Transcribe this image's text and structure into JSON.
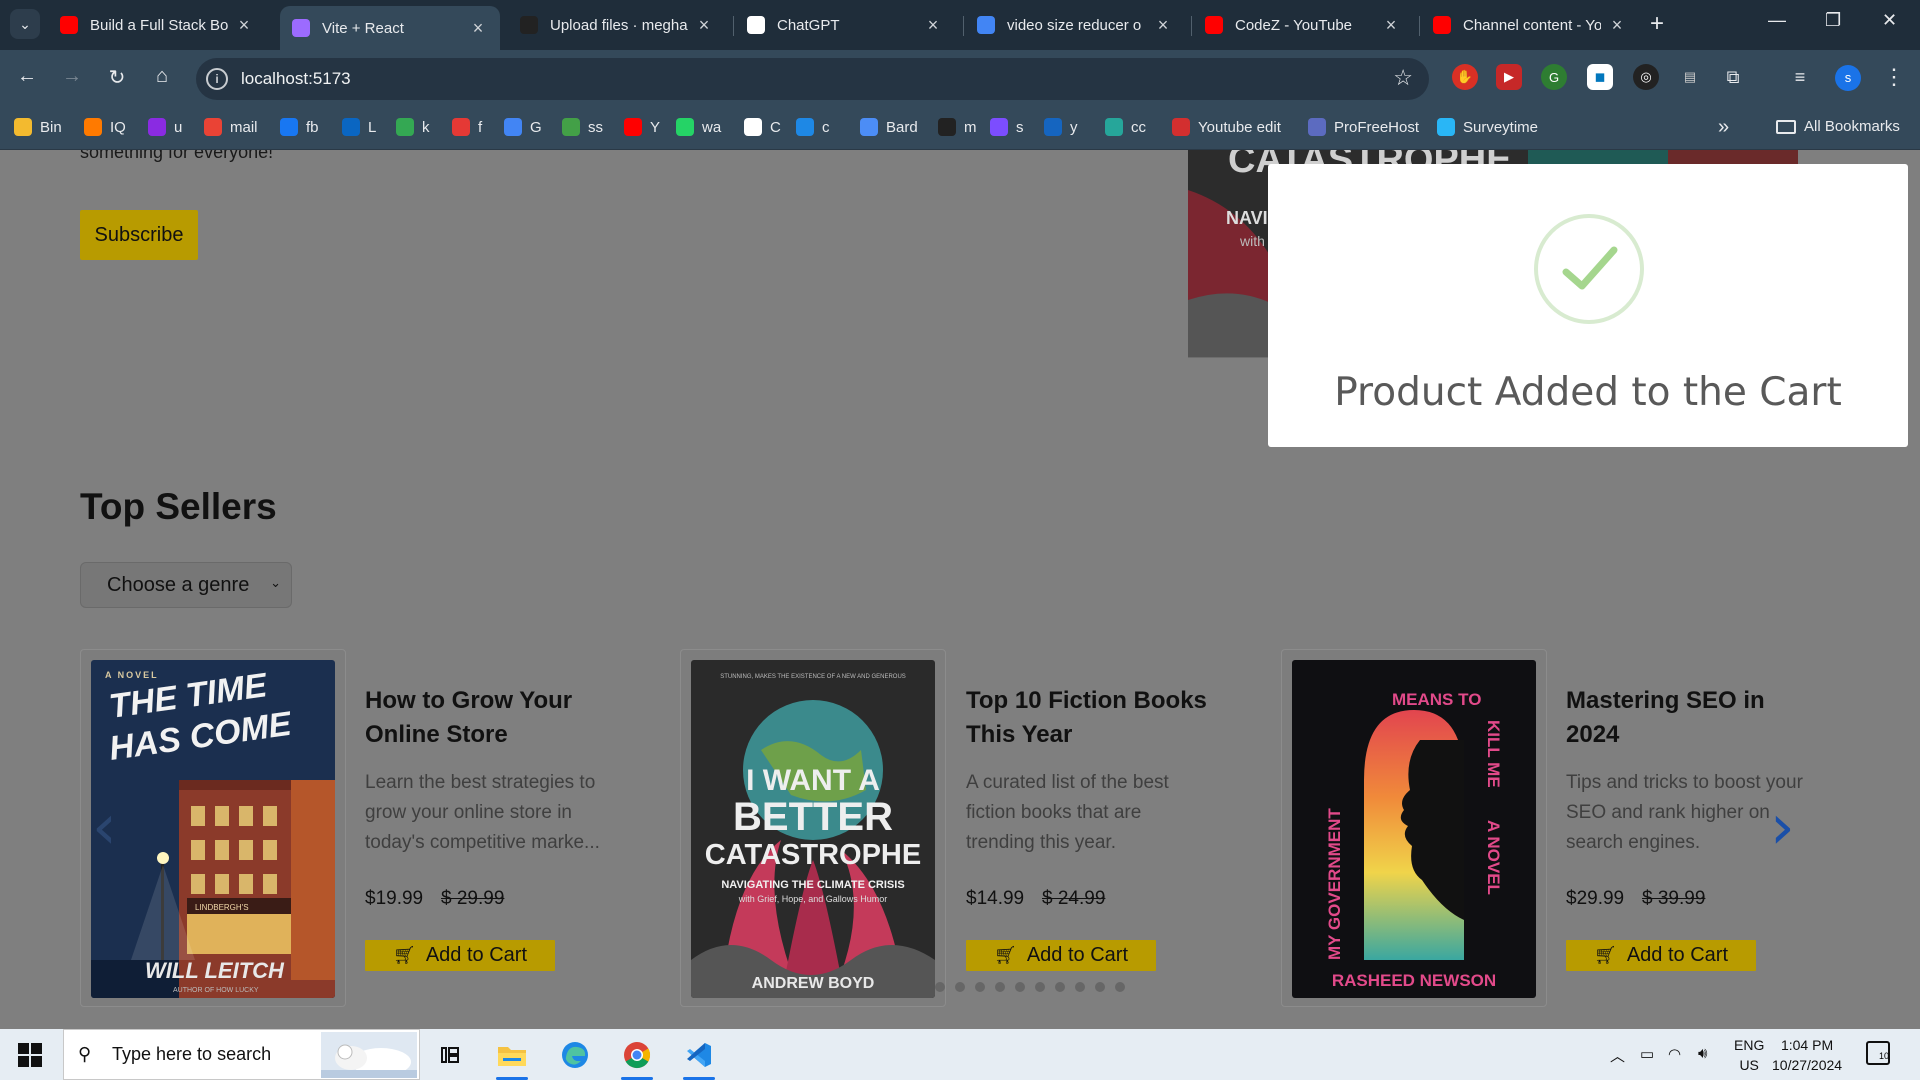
{
  "browser": {
    "tabs": [
      {
        "title": "Build a Full Stack Boo",
        "icon": "youtube-icon",
        "color": "#ff0000"
      },
      {
        "title": "Vite + React",
        "icon": "vite-icon",
        "color": "#9c6bff",
        "active": true
      },
      {
        "title": "Upload files · megha",
        "icon": "github-icon",
        "color": "#222222"
      },
      {
        "title": "ChatGPT",
        "icon": "chatgpt-icon",
        "color": "#ffffff"
      },
      {
        "title": "video size reducer o",
        "icon": "google-icon",
        "color": "#4285f4"
      },
      {
        "title": "CodeZ - YouTube",
        "icon": "youtube-icon",
        "color": "#ff0000"
      },
      {
        "title": "Channel content - Yo",
        "icon": "youtube-icon",
        "color": "#ff0000"
      }
    ],
    "url": "localhost:5173",
    "profile_initial": "s",
    "bookmarks": [
      {
        "label": "Bin",
        "color": "#f3ba2f"
      },
      {
        "label": "IQ",
        "color": "#ff7a00"
      },
      {
        "label": "u",
        "color": "#8a2be2"
      },
      {
        "label": "mail",
        "color": "#ea4335"
      },
      {
        "label": "fb",
        "color": "#1877f2"
      },
      {
        "label": "L",
        "color": "#0a66c2"
      },
      {
        "label": "k",
        "color": "#34a853"
      },
      {
        "label": "f",
        "color": "#e53935"
      },
      {
        "label": "G",
        "color": "#4285f4"
      },
      {
        "label": "ss",
        "color": "#43a047"
      },
      {
        "label": "Y",
        "color": "#ff0000"
      },
      {
        "label": "wa",
        "color": "#25d366"
      },
      {
        "label": "C",
        "color": "#ffffff"
      },
      {
        "label": "c",
        "color": "#1e88e5"
      },
      {
        "label": "Bard",
        "color": "#4c8df6"
      },
      {
        "label": "m",
        "color": "#222222"
      },
      {
        "label": "s",
        "color": "#7c4dff"
      },
      {
        "label": "y",
        "color": "#1565c0"
      },
      {
        "label": "cc",
        "color": "#26a69a"
      },
      {
        "label": "Youtube edit",
        "color": "#d32f2f"
      },
      {
        "label": "ProFreeHost",
        "color": "#5c6bc0"
      },
      {
        "label": "Surveytime",
        "color": "#29b6f6"
      }
    ],
    "all_bookmarks": "All Bookmarks"
  },
  "page": {
    "hero_fragment": "something for everyone!",
    "subscribe_label": "Subscribe",
    "section_title": "Top Sellers",
    "genre_select": "Choose a genre",
    "books": [
      {
        "title": "How to Grow Your Online Store",
        "description": "Learn the best strategies to grow your online store in today's competitive marke...",
        "price": "$19.99",
        "old_price": "$ 29.99",
        "cover": {
          "kicker": "A NOVEL",
          "title_lines": [
            "THE TIME",
            "HAS COME"
          ],
          "author": "WILL LEITCH",
          "sub": "AUTHOR OF HOW LUCKY",
          "sign": "LINDBERGH'S"
        }
      },
      {
        "title": "Top 10 Fiction Books This Year",
        "description": "A curated list of the best fiction books that are trending this year.",
        "price": "$14.99",
        "old_price": "$ 24.99",
        "cover": {
          "title_lines": [
            "I WANT A",
            "BETTER",
            "CATASTROPHE"
          ],
          "sub1": "NAVIGATING THE CLIMATE CRISIS",
          "sub2": "with Grief, Hope, and Gallows Humor",
          "author": "ANDREW BOYD"
        }
      },
      {
        "title": "Mastering SEO in 2024",
        "description": "Tips and tricks to boost your SEO and rank higher on search engines.",
        "price": "$29.99",
        "old_price": "$ 39.99",
        "cover": {
          "title_lines": [
            "MY GOVERNMENT",
            "MEANS TO",
            "KILL ME",
            "A NOVEL"
          ],
          "author": "RASHEED NEWSON"
        }
      }
    ],
    "add_to_cart_label": "Add to Cart",
    "carousel_dots": 10
  },
  "toast": {
    "message": "Product Added to the Cart"
  },
  "taskbar": {
    "search_placeholder": "Type here to search",
    "lang": "ENG",
    "region": "US",
    "time": "1:04 PM",
    "date": "10/27/2024",
    "notification_count": "10"
  }
}
